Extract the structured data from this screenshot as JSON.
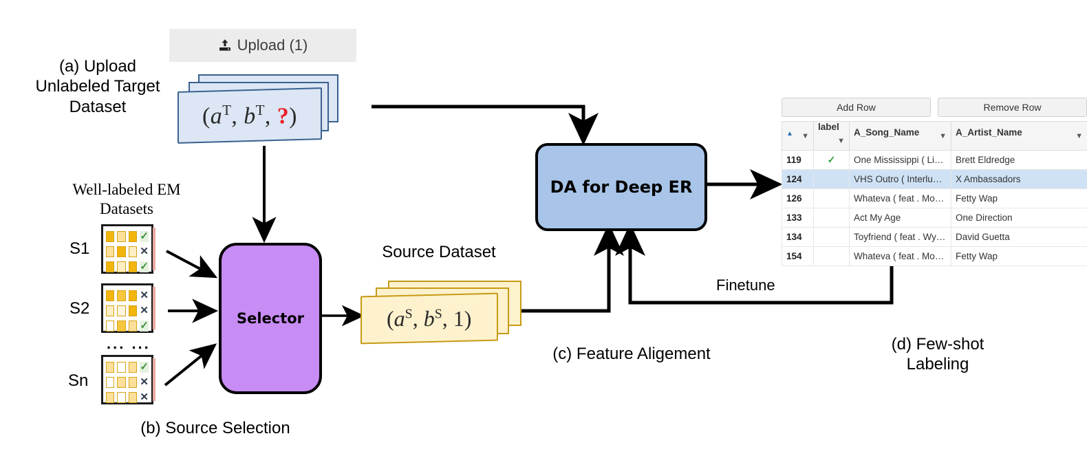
{
  "captions": {
    "a": "(a)  Upload\nUnlabeled Target\nDataset",
    "b": "(b) Source Selection",
    "c": "(c) Feature Aligement",
    "d": "(d)  Few-shot\nLabeling",
    "well_labeled": "Well-labeled EM\nDatasets",
    "source_dataset": "Source Dataset",
    "finetune": "Finetune"
  },
  "upload": {
    "label": "Upload (1)",
    "icon": "upload-icon"
  },
  "target_dataset": {
    "open_paren": "(",
    "a": "a",
    "a_sup": "T",
    "comma1": ",",
    "b": "b",
    "b_sup": "T",
    "comma2": ",",
    "question": "?",
    "close_paren": ")"
  },
  "source_dataset_card": {
    "open_paren": "(",
    "a": "a",
    "a_sup": "S",
    "comma1": ",",
    "b": "b",
    "b_sup": "S",
    "comma2": ",",
    "one": "1",
    "close_paren": ")"
  },
  "boxes": {
    "selector": "Selector",
    "da": "DA for Deep ER",
    "selector_color": "#c88cf5",
    "da_color": "#a8c4e8"
  },
  "em_datasets": [
    {
      "label": "S1",
      "rows": [
        {
          "cells": [
            "#f2b50d",
            "#fbdf9a",
            "#f2b50d"
          ],
          "mark": "check"
        },
        {
          "cells": [
            "#fbdf9a",
            "#f2b50d",
            "#fdeec4"
          ],
          "mark": "cross"
        },
        {
          "cells": [
            "#f2b50d",
            "#fdeec4",
            "#f2b50d"
          ],
          "mark": "check"
        }
      ]
    },
    {
      "label": "S2",
      "rows": [
        {
          "cells": [
            "#f2b50d",
            "#f6c63f",
            "#f2b50d"
          ],
          "mark": "cross"
        },
        {
          "cells": [
            "#fdeec4",
            "#fdf4dc",
            "#f2b50d"
          ],
          "mark": "cross"
        },
        {
          "cells": [
            "#ffffff",
            "#f6c63f",
            "#fbdf9a"
          ],
          "mark": "check"
        }
      ]
    },
    {
      "label": "Sn",
      "rows": [
        {
          "cells": [
            "#fbdf9a",
            "#ffffff",
            "#fbdf9a"
          ],
          "mark": "check"
        },
        {
          "cells": [
            "#ffffff",
            "#fbdf9a",
            "#fbdf9a"
          ],
          "mark": "cross"
        },
        {
          "cells": [
            "#fbdf9a",
            "#ffffff",
            "#fbdf9a"
          ],
          "mark": "cross"
        }
      ]
    }
  ],
  "ellipsis": "...  ...",
  "table": {
    "buttons": [
      "Add Row",
      "Remove Row"
    ],
    "columns": [
      {
        "label": "",
        "filter": true,
        "sort": true
      },
      {
        "label": "label",
        "filter": true,
        "sort": false
      },
      {
        "label": "A_Song_Name",
        "filter": true,
        "sort": false
      },
      {
        "label": "A_Artist_Name",
        "filter": true,
        "sort": false
      }
    ],
    "rows": [
      {
        "id": "119",
        "label": "check",
        "song": "One Mississippi ( Live ...",
        "artist": "Brett Eldredge",
        "selected": false
      },
      {
        "id": "124",
        "label": "",
        "song": "VHS Outro ( Interlude )",
        "artist": "X Ambassadors",
        "selected": true
      },
      {
        "id": "126",
        "label": "",
        "song": "Whateva ( feat . Monty )",
        "artist": "Fetty Wap",
        "selected": false
      },
      {
        "id": "133",
        "label": "",
        "song": "Act My Age",
        "artist": "One Direction",
        "selected": false
      },
      {
        "id": "134",
        "label": "",
        "song": "Toyfriend ( feat . Wynt...",
        "artist": "David Guetta",
        "selected": false
      },
      {
        "id": "154",
        "label": "",
        "song": "Whateva ( feat . Monty )",
        "artist": "Fetty Wap",
        "selected": false
      }
    ]
  }
}
